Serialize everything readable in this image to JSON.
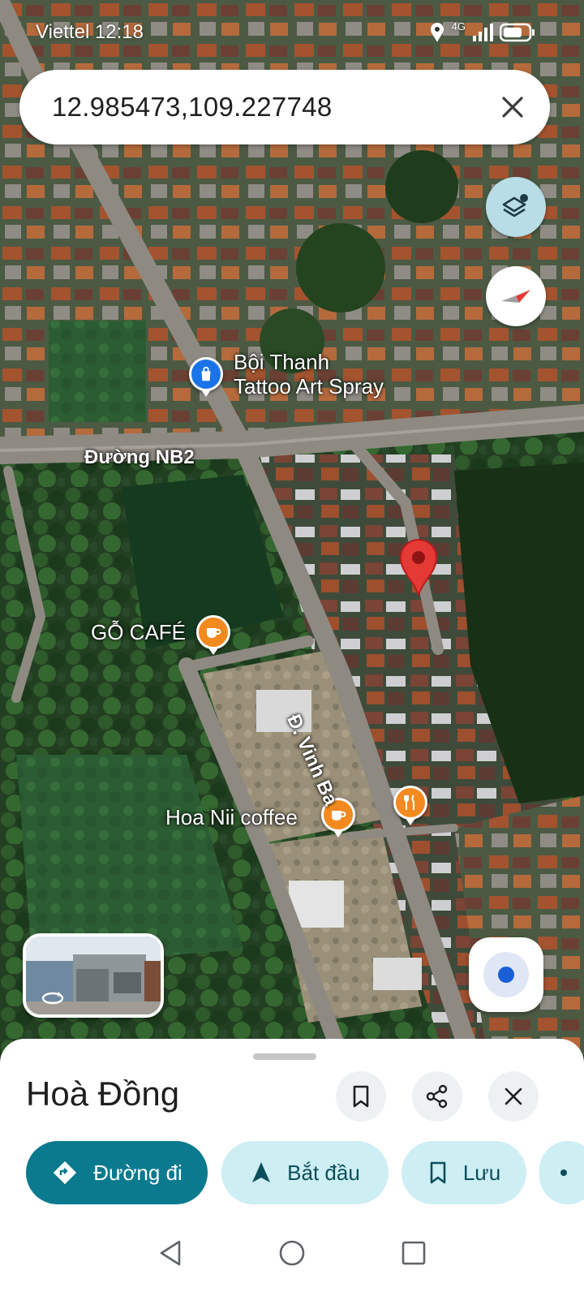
{
  "status_bar": {
    "carrier_time": "Viettel 12:18",
    "network": "4G"
  },
  "search": {
    "query": "12.985473,109.227748"
  },
  "map": {
    "road_labels": [
      "Đường NB2",
      "Đ. Vinh Ba"
    ],
    "places": [
      {
        "name_line1": "Bội Thanh",
        "name_line2": "Tattoo Art Spray",
        "icon": "shopping-bag-icon"
      },
      {
        "name": "GỖ CAFÉ",
        "icon": "coffee-cup-icon"
      },
      {
        "name": "Hoa Nii coffee",
        "icon": "coffee-cup-icon"
      },
      {
        "name": "",
        "icon": "restaurant-icon"
      }
    ],
    "pin_color": "#e53935"
  },
  "sheet": {
    "title": "Hoà Đồng",
    "actions": {
      "directions": "Đường đi",
      "start": "Bắt đầu",
      "save": "Lưu"
    }
  },
  "colors": {
    "primary_chip": "#0b7a8f",
    "secondary_chip": "#cdeef3",
    "cafe_poi": "#f28a1f",
    "shop_poi": "#1a73e8"
  }
}
